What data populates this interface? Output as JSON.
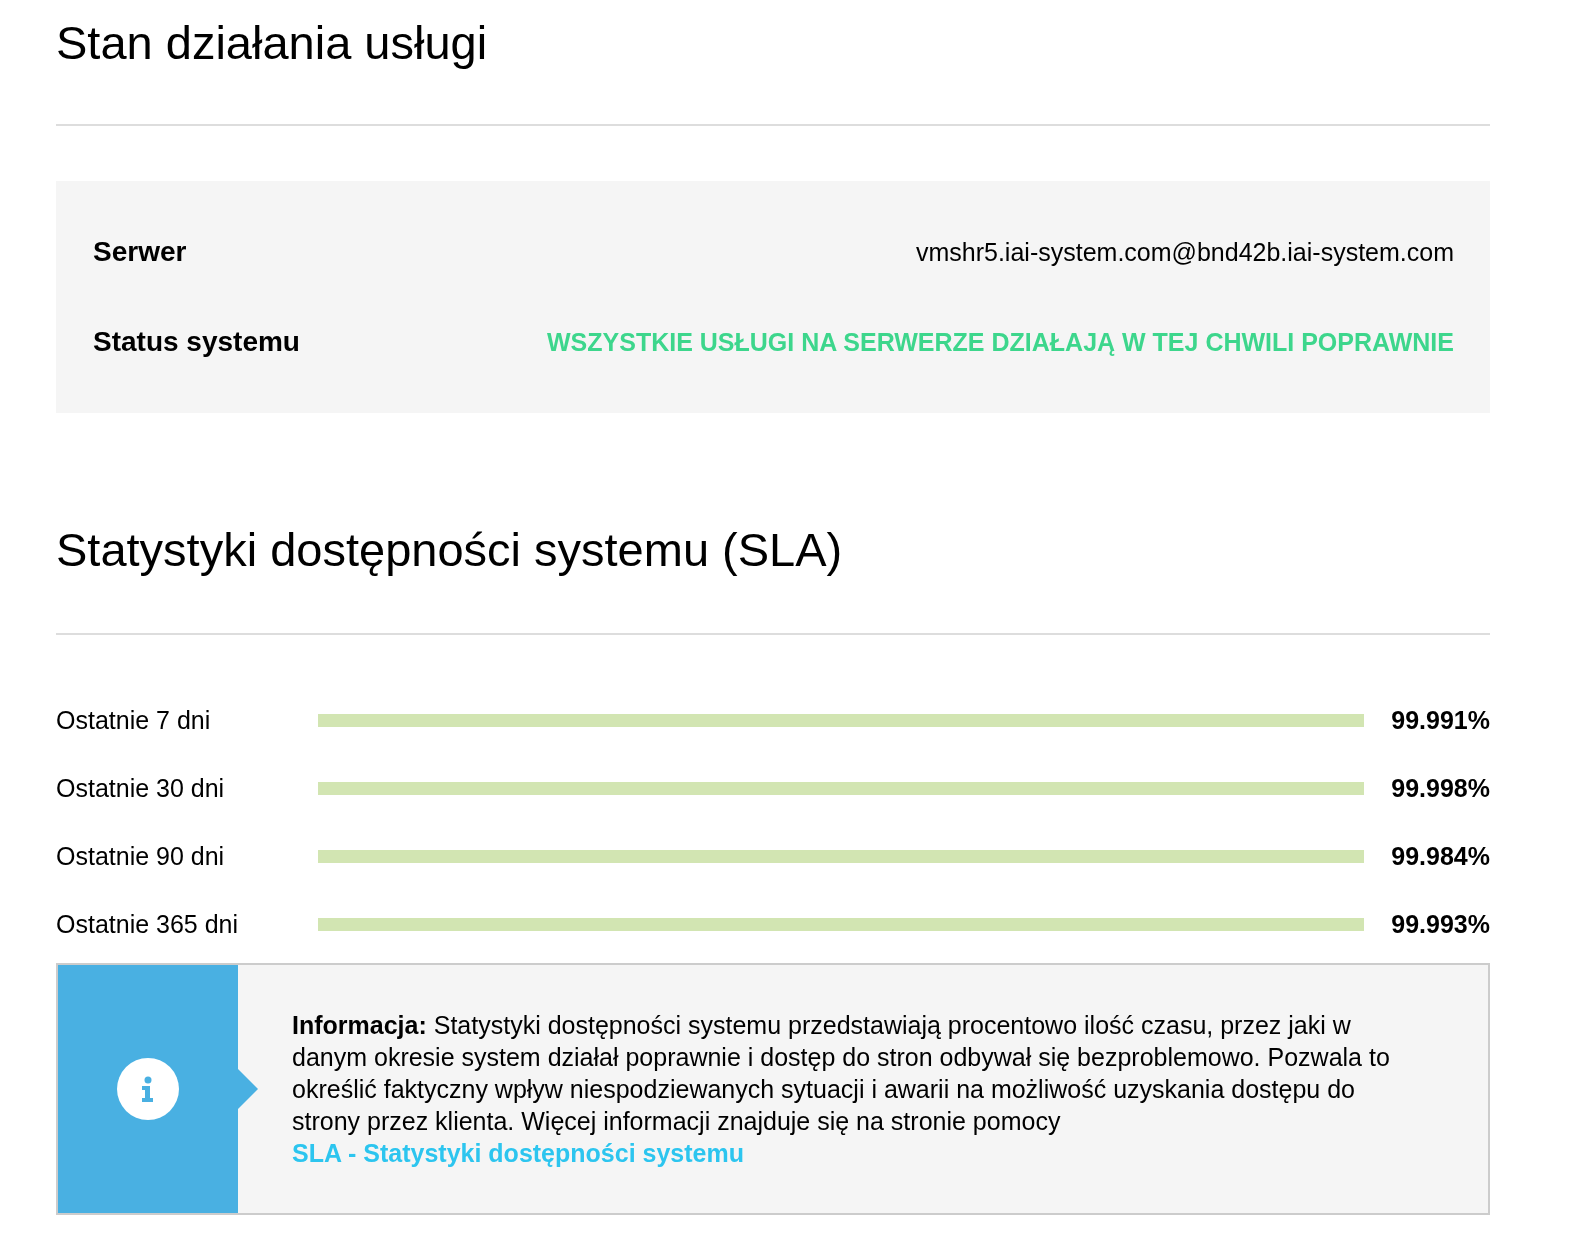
{
  "service_status": {
    "title": "Stan działania usługi",
    "rows": [
      {
        "label": "Serwer",
        "value": "vmshr5.iai-system.com@bnd42b.iai-system.com",
        "kind": "plain"
      },
      {
        "label": "Status systemu",
        "value": "WSZYSTKIE USŁUGI NA SERWERZE DZIAŁAJĄ W TEJ CHWILI POPRAWNIE",
        "kind": "ok"
      }
    ]
  },
  "sla": {
    "title": "Statystyki dostępności systemu (SLA)",
    "rows": [
      {
        "label": "Ostatnie 7 dni",
        "level": 0.99991,
        "reading": "99.991%"
      },
      {
        "label": "Ostatnie 30 dni",
        "level": 0.99998,
        "reading": "99.998%"
      },
      {
        "label": "Ostatnie 90 dni",
        "level": 0.99984,
        "reading": "99.984%"
      },
      {
        "label": "Ostatnie 365 dni",
        "level": 0.99993,
        "reading": "99.993%"
      }
    ]
  },
  "info": {
    "text": "**Informacja:** Statystyki dostępności systemu przedstawiają procentowo ilość czasu, przez jaki w danym okresie system działał poprawnie i dostęp do stron odbywał się bezproblemowo. Pozwala to określić faktyczny wpływ niespodziewanych sytuacji i awarii na możliwość uzyskania dostępu do strony przez klienta. Więcej informacji znajduje się na stronie pomocy",
    "link": "SLA - Statystyki dostępności systemu"
  }
}
